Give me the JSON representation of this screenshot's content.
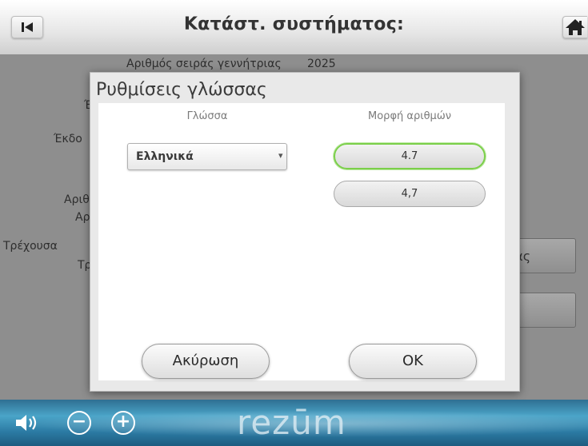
{
  "header": {
    "title": "Κατάστ. συστήματος:"
  },
  "background": {
    "generator_serial_label": "Αριθμός σειράς γεννήτριας",
    "generator_serial_value": "2025",
    "frag_1": "Έ",
    "frag_2": "Έκδο",
    "frag_3": "Αριθ",
    "frag_4": "Αρ",
    "frag_5": "Τρέχουσα",
    "frag_6": "Τρ",
    "button_1_text": "ρας",
    "button_2_text": ""
  },
  "dialog": {
    "title": "Ρυθμίσεις γλώσσας",
    "language_label": "Γλώσσα",
    "number_format_label": "Μορφή αριθμών",
    "language_value": "Ελληνικά",
    "number_formats": [
      "4.7",
      "4,7"
    ],
    "selected_number_format": "4.7",
    "cancel_label": "Ακύρωση",
    "ok_label": "OK"
  },
  "footer": {
    "logo_text": "rezūm",
    "volume_down_symbol": "−",
    "volume_up_symbol": "+"
  },
  "icons": {
    "back": "back-icon",
    "home": "home-icon",
    "speaker": "speaker-icon"
  },
  "colors": {
    "selected_outline": "#7bcf4a",
    "footer_blue": "#2b7aa3"
  }
}
